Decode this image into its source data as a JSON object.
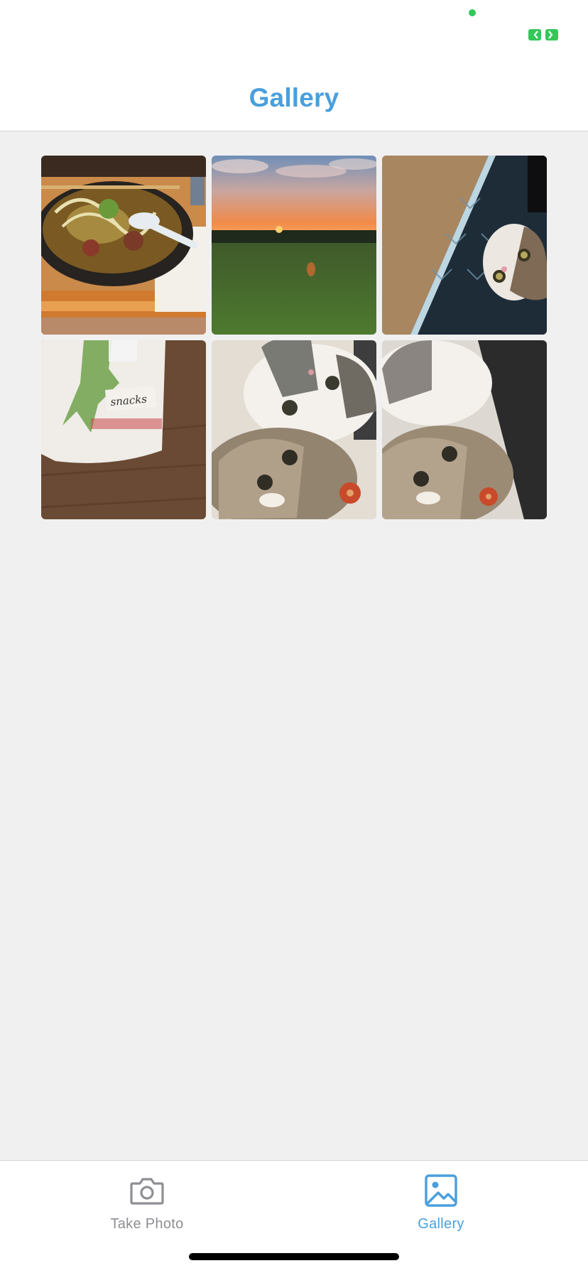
{
  "header": {
    "title": "Gallery"
  },
  "colors": {
    "accent": "#4a9fdc",
    "inactive": "#8e8e93",
    "background": "#f0f0f0",
    "status_green": "#34c759"
  },
  "gallery": {
    "photos": [
      {
        "subject": "noodle-soup-bowl",
        "icon": "photo-thumbnail"
      },
      {
        "subject": "sunset-over-field",
        "icon": "photo-thumbnail"
      },
      {
        "subject": "cat-in-box",
        "icon": "photo-thumbnail"
      },
      {
        "subject": "snacks-container",
        "handwritten_label": "snacks",
        "icon": "photo-thumbnail"
      },
      {
        "subject": "two-cats-selfie",
        "icon": "photo-thumbnail"
      },
      {
        "subject": "two-cats-selfie-alt",
        "icon": "photo-thumbnail"
      }
    ]
  },
  "tab_bar": {
    "tabs": [
      {
        "label": "Take Photo",
        "icon": "camera-icon",
        "active": false
      },
      {
        "label": "Gallery",
        "icon": "image-icon",
        "active": true
      }
    ]
  }
}
